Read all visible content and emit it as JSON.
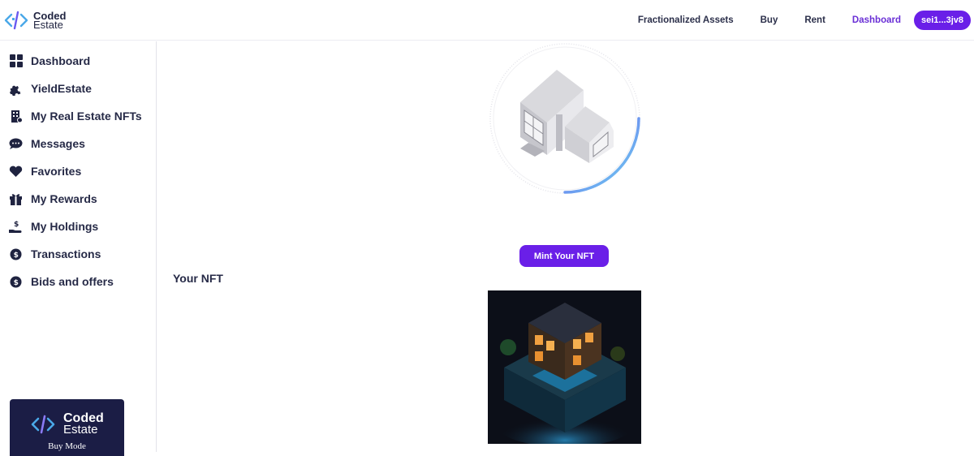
{
  "brand": {
    "line1": "Coded",
    "line2": "Estate"
  },
  "nav": {
    "items": [
      "Fractionalized Assets",
      "Buy",
      "Rent",
      "Dashboard"
    ],
    "active": "Dashboard",
    "wallet": "sei1...3jv8"
  },
  "sidebar": {
    "items": [
      {
        "label": "Dashboard",
        "icon": "grid-icon"
      },
      {
        "label": "YieldEstate",
        "icon": "puzzle-icon"
      },
      {
        "label": "My Real Estate NFTs",
        "icon": "building-icon"
      },
      {
        "label": "Messages",
        "icon": "chat-icon"
      },
      {
        "label": "Favorites",
        "icon": "heart-icon"
      },
      {
        "label": "My Rewards",
        "icon": "gift-icon"
      },
      {
        "label": "My Holdings",
        "icon": "hand-dollar-icon"
      },
      {
        "label": "Transactions",
        "icon": "coin-icon"
      },
      {
        "label": "Bids and offers",
        "icon": "coin-icon"
      }
    ],
    "mode_card": {
      "line1": "Coded",
      "line2": "Estate",
      "mode": "Buy Mode"
    }
  },
  "main": {
    "mint_button": "Mint Your NFT",
    "your_nft_heading": "Your NFT"
  },
  "colors": {
    "accent": "#6a1fe8",
    "nav_active": "#6a2fd6",
    "text": "#262a47",
    "card_bg": "#1b1d45"
  }
}
